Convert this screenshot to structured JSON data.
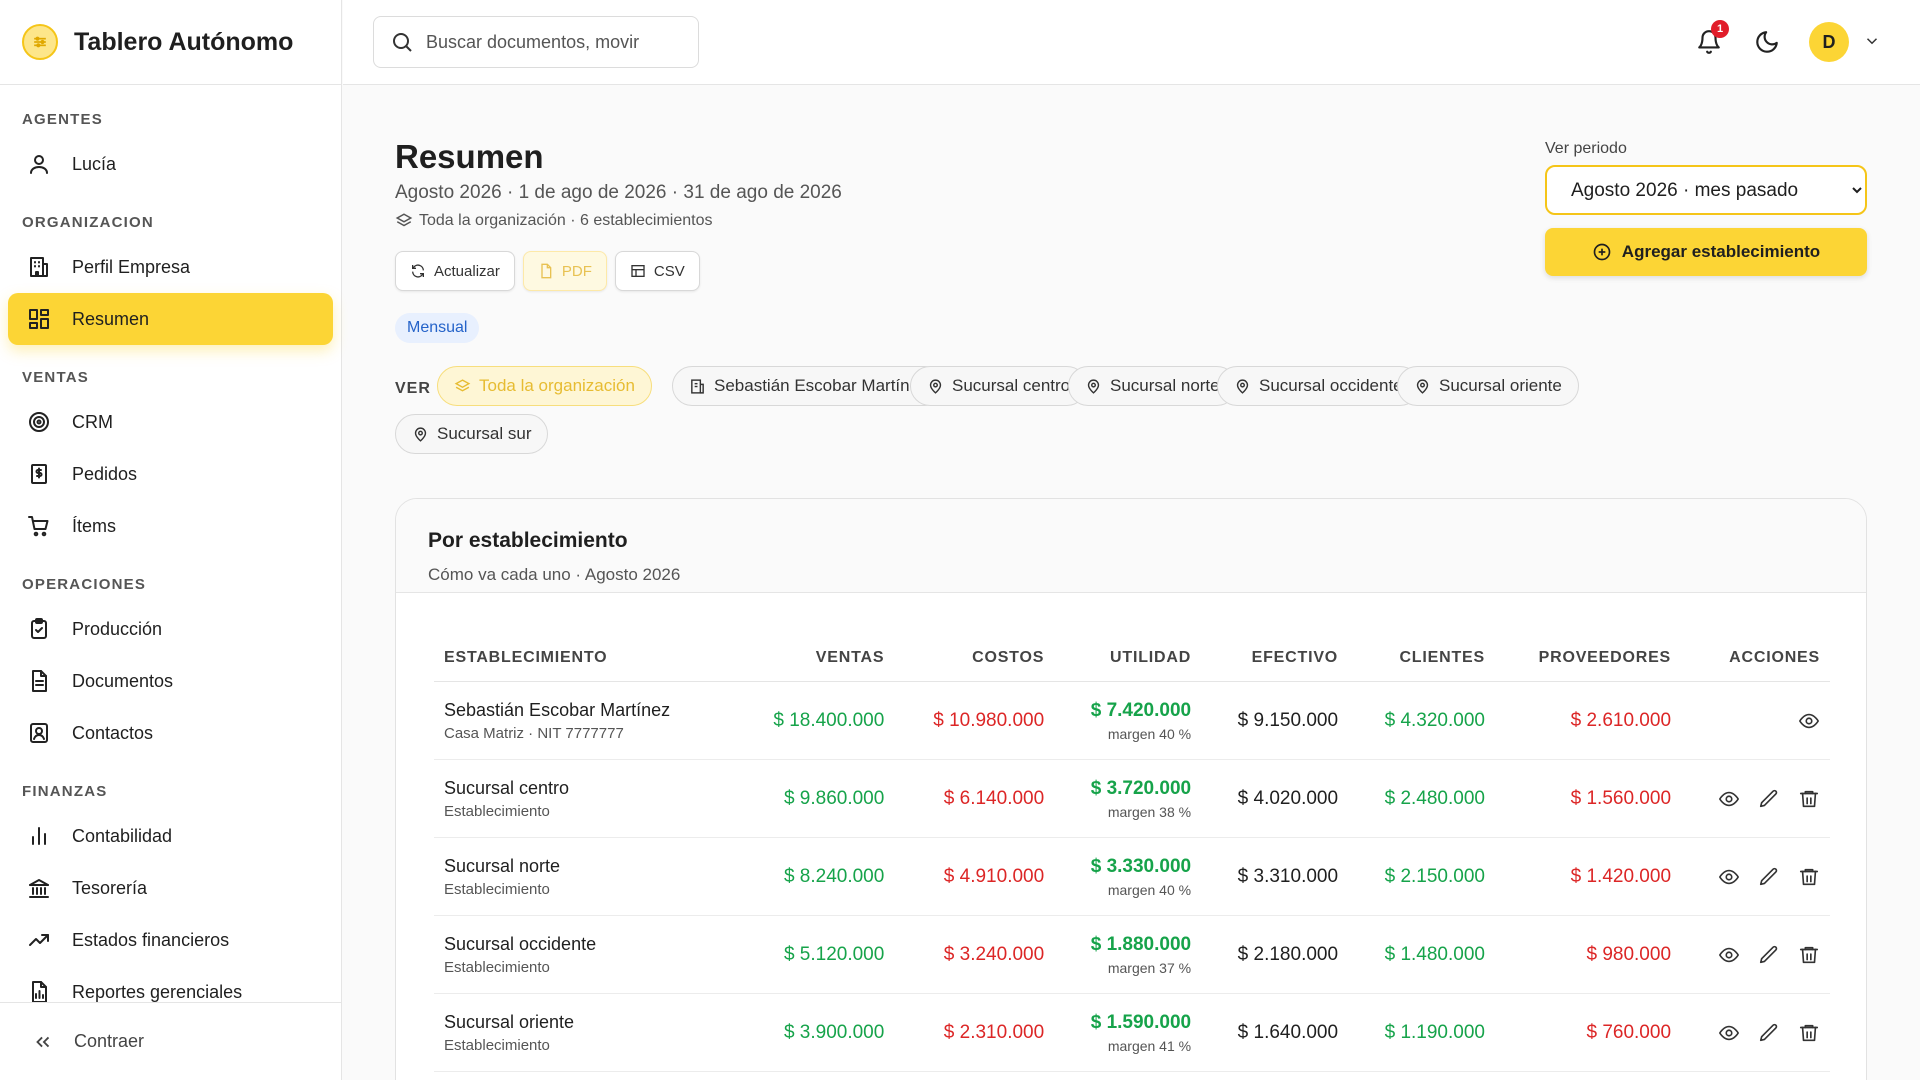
{
  "app": {
    "title": "Tablero Autónomo"
  },
  "sidebar": {
    "sections": {
      "agentes": "AGENTES",
      "organizacion": "ORGANIZACION",
      "ventas": "VENTAS",
      "operaciones": "OPERACIONES",
      "finanzas": "FINANZAS"
    },
    "items": {
      "lucia": "Lucía",
      "perfil": "Perfil Empresa",
      "resumen": "Resumen",
      "crm": "CRM",
      "pedidos": "Pedidos",
      "items": "Ítems",
      "produccion": "Producción",
      "documentos": "Documentos",
      "contactos": "Contactos",
      "contabilidad": "Contabilidad",
      "tesoreria": "Tesorería",
      "estados": "Estados financieros",
      "reportes": "Reportes gerenciales"
    },
    "collapse": "Contraer"
  },
  "topbar": {
    "search_placeholder": "Buscar documentos, movir",
    "notif_count": "1",
    "avatar_initial": "D"
  },
  "header": {
    "title": "Resumen",
    "subtitle": "Agosto 2026 · 1 de ago de 2026 · 31 de ago de 2026",
    "scope": "Toda la organización · 6 establecimientos",
    "btn_refresh": "Actualizar",
    "btn_pdf": "PDF",
    "btn_csv": "CSV",
    "chip": "Mensual",
    "period_label": "Ver periodo",
    "period_value": "Agosto 2026 · mes pasado",
    "btn_add": "Agregar establecimiento"
  },
  "filters": {
    "label": "VER",
    "options": [
      "Toda la organización",
      "Sebastián Escobar Martínez",
      "Sucursal centro",
      "Sucursal norte",
      "Sucursal occidente",
      "Sucursal oriente",
      "Sucursal sur"
    ]
  },
  "card": {
    "title": "Por establecimiento",
    "subtitle": "Cómo va cada uno · Agosto 2026",
    "columns": [
      "ESTABLECIMIENTO",
      "VENTAS",
      "COSTOS",
      "UTILIDAD",
      "EFECTIVO",
      "CLIENTES",
      "PROVEEDORES",
      "ACCIONES"
    ],
    "rows": [
      {
        "name": "Sebastián Escobar Martínez",
        "sub": "Casa Matriz · NIT 7777777",
        "ventas": "$ 18.400.000",
        "costos": "$ 10.980.000",
        "utilidad": "$ 7.420.000",
        "margen": "margen 40 %",
        "efectivo": "$ 9.150.000",
        "clientes": "$ 4.320.000",
        "proveedores": "$ 2.610.000"
      },
      {
        "name": "Sucursal centro",
        "sub": "Establecimiento",
        "ventas": "$ 9.860.000",
        "costos": "$ 6.140.000",
        "utilidad": "$ 3.720.000",
        "margen": "margen 38 %",
        "efectivo": "$ 4.020.000",
        "clientes": "$ 2.480.000",
        "proveedores": "$ 1.560.000"
      },
      {
        "name": "Sucursal norte",
        "sub": "Establecimiento",
        "ventas": "$ 8.240.000",
        "costos": "$ 4.910.000",
        "utilidad": "$ 3.330.000",
        "margen": "margen 40 %",
        "efectivo": "$ 3.310.000",
        "clientes": "$ 2.150.000",
        "proveedores": "$ 1.420.000"
      },
      {
        "name": "Sucursal occidente",
        "sub": "Establecimiento",
        "ventas": "$ 5.120.000",
        "costos": "$ 3.240.000",
        "utilidad": "$ 1.880.000",
        "margen": "margen 37 %",
        "efectivo": "$ 2.180.000",
        "clientes": "$ 1.480.000",
        "proveedores": "$ 980.000"
      },
      {
        "name": "Sucursal oriente",
        "sub": "Establecimiento",
        "ventas": "$ 3.900.000",
        "costos": "$ 2.310.000",
        "utilidad": "$ 1.590.000",
        "margen": "margen 41 %",
        "efectivo": "$ 1.640.000",
        "clientes": "$ 1.190.000",
        "proveedores": "$ 760.000"
      }
    ]
  },
  "colors": {
    "accent": "#fcd535",
    "positive": "#16a34a",
    "negative": "#dc2626",
    "info": "#2563c9"
  }
}
